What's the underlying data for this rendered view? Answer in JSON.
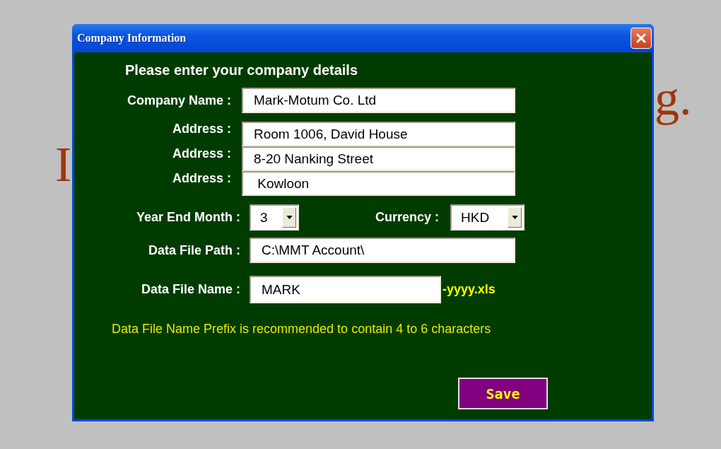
{
  "background_text": {
    "left": [
      "I"
    ],
    "right": [
      "g."
    ]
  },
  "window": {
    "title": "Company Information"
  },
  "heading": "Please enter your company details",
  "company_name": {
    "label": "Company Name :",
    "value": "Mark-Motum Co. Ltd"
  },
  "addresses": [
    {
      "label": "Address :",
      "value": "Room 1006, David House"
    },
    {
      "label": "Address :",
      "value": "8-20 Nanking Street"
    },
    {
      "label": "Address :",
      "value": " Kowloon"
    }
  ],
  "year_end_month": {
    "label": "Year End Month :",
    "value": "3"
  },
  "currency": {
    "label": "Currency :",
    "value": "HKD"
  },
  "data_file_path": {
    "label": "Data File Path :",
    "value": "C:\\MMT Account\\"
  },
  "data_file_name": {
    "label": "Data File Name :",
    "value": "MARK",
    "suffix": "-yyyy.xls"
  },
  "hint": "Data File Name Prefix is recommended to contain 4 to 6 characters",
  "save_button": "Save"
}
